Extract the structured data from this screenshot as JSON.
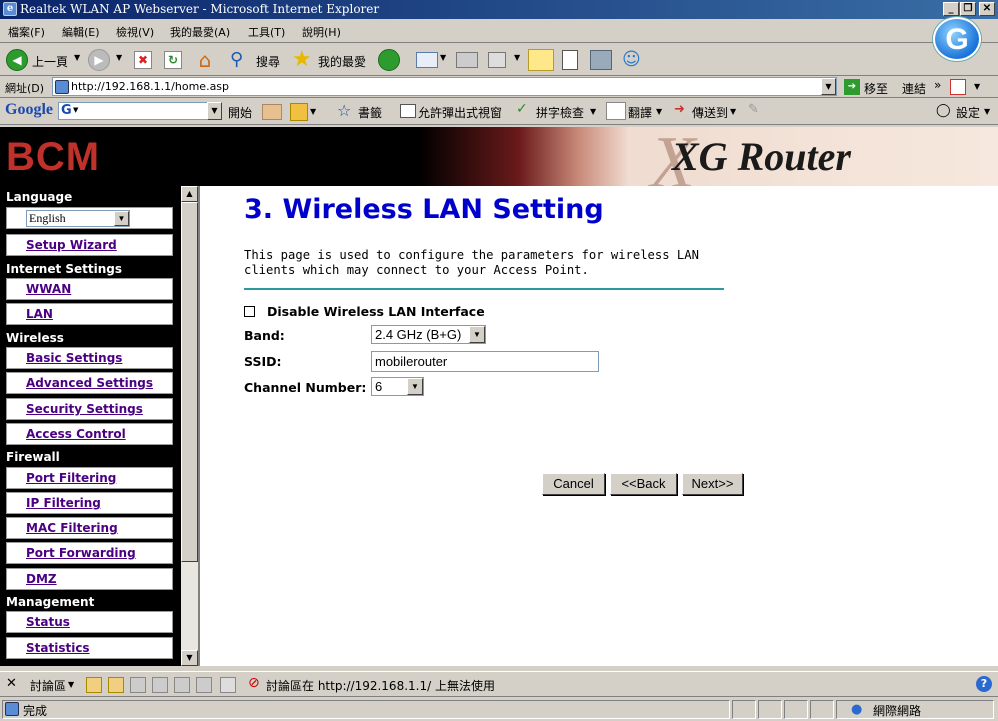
{
  "window": {
    "title": "Realtek WLAN AP Webserver - Microsoft Internet Explorer",
    "minimize": "_",
    "restore": "❐",
    "close": "✕"
  },
  "menu": [
    "檔案(F)",
    "編輯(E)",
    "檢視(V)",
    "我的最愛(A)",
    "工具(T)",
    "說明(H)"
  ],
  "toolbar": {
    "back_label": "上一頁",
    "search_label": "搜尋",
    "favorites_label": "我的最愛"
  },
  "address": {
    "label": "網址(D)",
    "url": "http://192.168.1.1/home.asp",
    "go_label": "移至",
    "links_label": "連結"
  },
  "google_toolbar": {
    "brand": "Google",
    "g": "G",
    "start_label": "開始",
    "bookmarks_label": "書籤",
    "popup_label": "允許彈出式視窗",
    "spellcheck_label": "拼字檢查",
    "translate_label": "翻譯",
    "sendto_label": "傳送到",
    "settings_label": "設定"
  },
  "banner": {
    "brand": "BCM",
    "product": "XG Router",
    "x_mark": "X"
  },
  "sidebar": {
    "language_heading": "Language",
    "language_value": "English",
    "setup_wizard": "Setup Wizard",
    "internet_heading": "Internet Settings",
    "wwan": "WWAN",
    "lan": "LAN",
    "wireless_heading": "Wireless",
    "basic": "Basic Settings",
    "advanced": "Advanced Settings",
    "security": "Security Settings",
    "access": "Access Control",
    "firewall_heading": "Firewall",
    "port_filtering": "Port Filtering",
    "ip_filtering": "IP Filtering",
    "mac_filtering": "MAC Filtering",
    "port_forwarding": "Port Forwarding",
    "dmz": "DMZ",
    "management_heading": "Management",
    "status": "Status",
    "statistics": "Statistics"
  },
  "main": {
    "title": "3. Wireless LAN Setting",
    "description": "This page is used to configure the parameters for wireless LAN clients which may connect to your Access Point.",
    "disable_label": "Disable Wireless LAN Interface",
    "band_label": "Band:",
    "band_value": "2.4 GHz (B+G)",
    "ssid_label": "SSID:",
    "ssid_value": "mobilerouter",
    "channel_label": "Channel Number:",
    "channel_value": "6",
    "cancel": "Cancel",
    "back": "<<Back",
    "next": "Next>>"
  },
  "discuss_bar": {
    "label": "討論區",
    "message": "討論區在 http://192.168.1.1/ 上無法使用"
  },
  "status_bar": {
    "status": "完成",
    "zone": "網際網路"
  }
}
